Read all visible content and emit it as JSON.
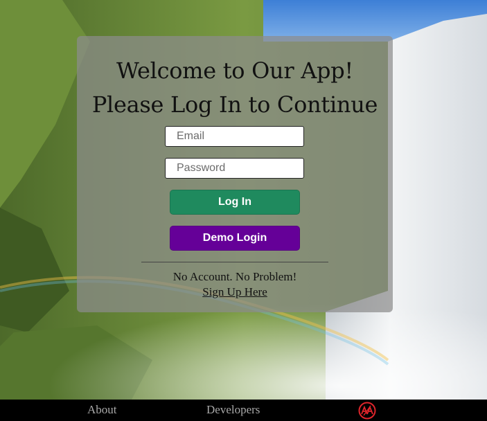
{
  "login": {
    "heading_line1": "Welcome to Our App!",
    "heading_line2": "Please Log In to Continue",
    "email_placeholder": "Email",
    "password_placeholder": "Password",
    "login_button": "Log In",
    "demo_button": "Demo Login",
    "no_account_text": "No Account. No Problem!",
    "signup_link": "Sign Up Here"
  },
  "footer": {
    "about_label": "About",
    "developers_label": "Developers",
    "logo_icon": "aa-monogram-icon"
  },
  "colors": {
    "login_button": "#1f8a5e",
    "demo_button": "#650098",
    "logo": "#e0252b",
    "footer_background": "#000000"
  }
}
